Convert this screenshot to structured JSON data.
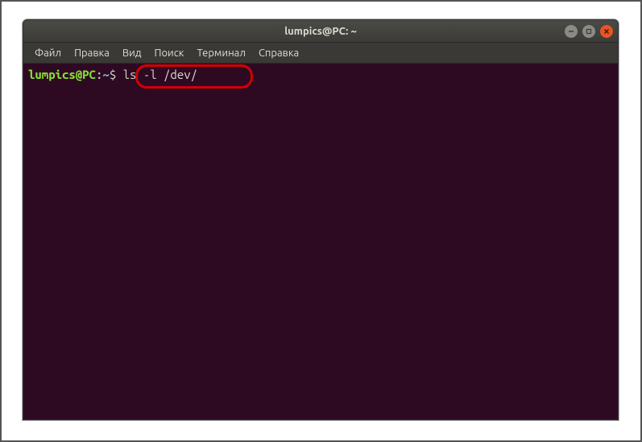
{
  "window": {
    "title": "lumpics@PC: ~"
  },
  "menubar": {
    "items": [
      {
        "label": "Файл"
      },
      {
        "label": "Правка"
      },
      {
        "label": "Вид"
      },
      {
        "label": "Поиск"
      },
      {
        "label": "Терминал"
      },
      {
        "label": "Справка"
      }
    ]
  },
  "terminal": {
    "prompt_user": "lumpics@PC",
    "prompt_colon": ":",
    "prompt_path": "~",
    "prompt_dollar": "$",
    "command": " ls -l /dev/"
  }
}
